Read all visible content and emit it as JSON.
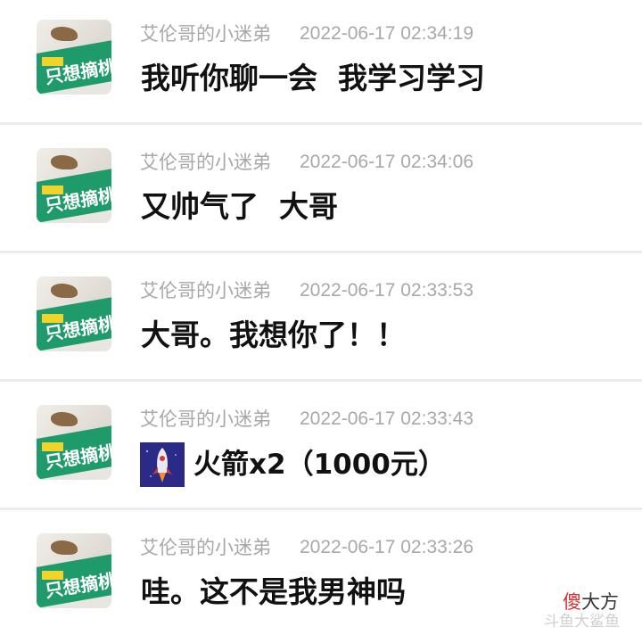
{
  "comments": [
    {
      "username": "艾伦哥的小迷弟",
      "timestamp": "2022-06-17 02:34:19",
      "message": "我听你聊一会  我学习学习",
      "avatar_text": "只想摘桃"
    },
    {
      "username": "艾伦哥的小迷弟",
      "timestamp": "2022-06-17 02:34:06",
      "message": "又帅气了  大哥",
      "avatar_text": "只想摘桃"
    },
    {
      "username": "艾伦哥的小迷弟",
      "timestamp": "2022-06-17 02:33:53",
      "message": "大哥。我想你了！！",
      "avatar_text": "只想摘桃"
    },
    {
      "username": "艾伦哥的小迷弟",
      "timestamp": "2022-06-17 02:33:43",
      "gift": {
        "icon": "rocket-icon",
        "label": "火箭x2（1000元）"
      },
      "avatar_text": "只想摘桃"
    },
    {
      "username": "艾伦哥的小迷弟",
      "timestamp": "2022-06-17 02:33:26",
      "message": "哇。这不是我男神吗",
      "avatar_text": "只想摘桃"
    }
  ],
  "watermark": {
    "char": "傻",
    "text": "大方",
    "sub": "斗鱼大鲨鱼"
  },
  "colors": {
    "meta_text": "#a8a8a8",
    "message_text": "#111111",
    "divider": "#ececec",
    "avatar_plate": "#1f9a6b",
    "gift_icon_bg": "#2b2a86",
    "watermark_accent": "#d0312d"
  }
}
